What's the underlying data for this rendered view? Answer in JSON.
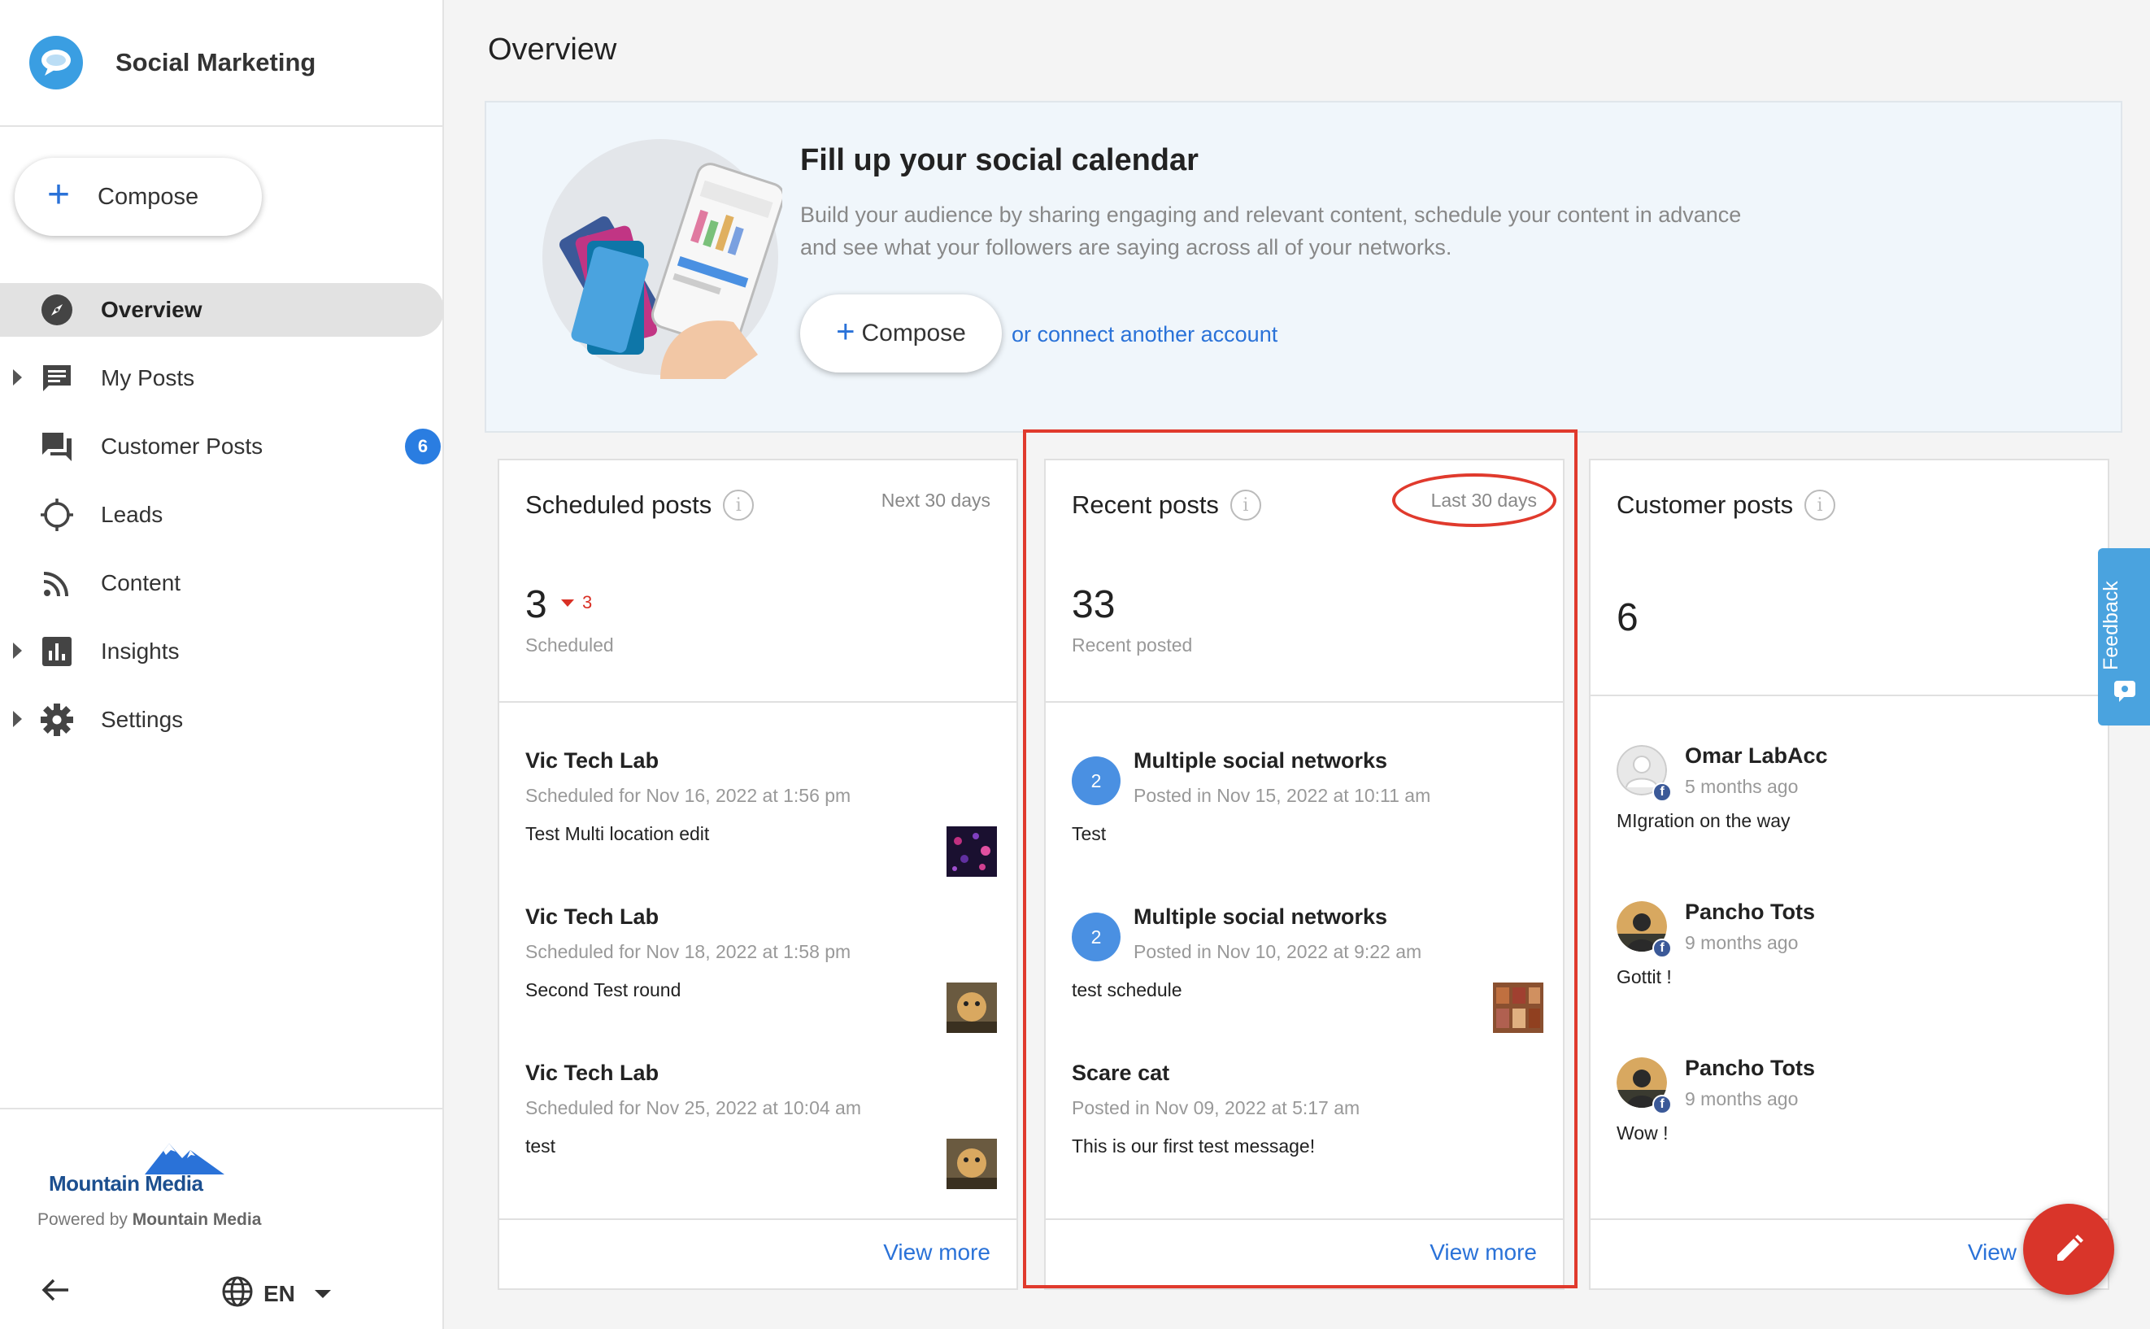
{
  "app": {
    "title": "Social Marketing",
    "accent": "#2a72d8"
  },
  "sidebar": {
    "compose_label": "Compose",
    "items": [
      {
        "label": "Overview",
        "icon": "compass-icon",
        "active": true
      },
      {
        "label": "My Posts",
        "icon": "message-icon",
        "expandable": true
      },
      {
        "label": "Customer Posts",
        "icon": "forum-icon",
        "badge": "6"
      },
      {
        "label": "Leads",
        "icon": "crosshair-icon"
      },
      {
        "label": "Content",
        "icon": "rss-icon"
      },
      {
        "label": "Insights",
        "icon": "insights-icon",
        "expandable": true
      },
      {
        "label": "Settings",
        "icon": "gear-icon",
        "expandable": true
      }
    ],
    "footer": {
      "logo_text": "Mountain Media",
      "powered_prefix": "Powered by ",
      "powered_brand": "Mountain Media",
      "language": "EN"
    }
  },
  "main": {
    "page_title": "Overview",
    "hero": {
      "title": "Fill up your social calendar",
      "description": "Build your audience by sharing engaging and relevant content, schedule your content in advance and see what your followers are saying across all of your networks.",
      "compose_label": "Compose",
      "link_text": "or connect another account"
    },
    "scheduled": {
      "title": "Scheduled posts",
      "range": "Next 30 days",
      "value": "3",
      "delta": "3",
      "subtitle": "Scheduled",
      "posts": [
        {
          "name": "Vic Tech Lab",
          "meta": "Scheduled for Nov 16, 2022 at 1:56 pm",
          "text": "Test Multi location edit"
        },
        {
          "name": "Vic Tech Lab",
          "meta": "Scheduled for Nov 18, 2022 at 1:58 pm",
          "text": "Second Test round"
        },
        {
          "name": "Vic Tech Lab",
          "meta": "Scheduled for Nov 25, 2022 at 10:04 am",
          "text": "test"
        }
      ],
      "view_more": "View more"
    },
    "recent": {
      "title": "Recent posts",
      "range": "Last 30 days",
      "value": "33",
      "subtitle": "Recent posted",
      "posts": [
        {
          "badge": "2",
          "name": "Multiple social networks",
          "meta": "Posted in Nov 15, 2022 at 10:11 am",
          "text": "Test"
        },
        {
          "badge": "2",
          "name": "Multiple social networks",
          "meta": "Posted in Nov 10, 2022 at 9:22 am",
          "text": "test schedule"
        },
        {
          "name": "Scare cat",
          "meta": "Posted in Nov 09, 2022 at 5:17 am",
          "text": "This is our first test message!"
        }
      ],
      "view_more": "View more"
    },
    "customer": {
      "title": "Customer posts",
      "value": "6",
      "posts": [
        {
          "name": "Omar LabAcc",
          "time": "5 months ago",
          "text": "MIgration on the way"
        },
        {
          "name": "Pancho Tots",
          "time": "9 months ago",
          "text": "Gottit !"
        },
        {
          "name": "Pancho Tots",
          "time": "9 months ago",
          "text": "Wow !"
        }
      ],
      "view_more": "View"
    },
    "feedback_label": "Feedback"
  }
}
